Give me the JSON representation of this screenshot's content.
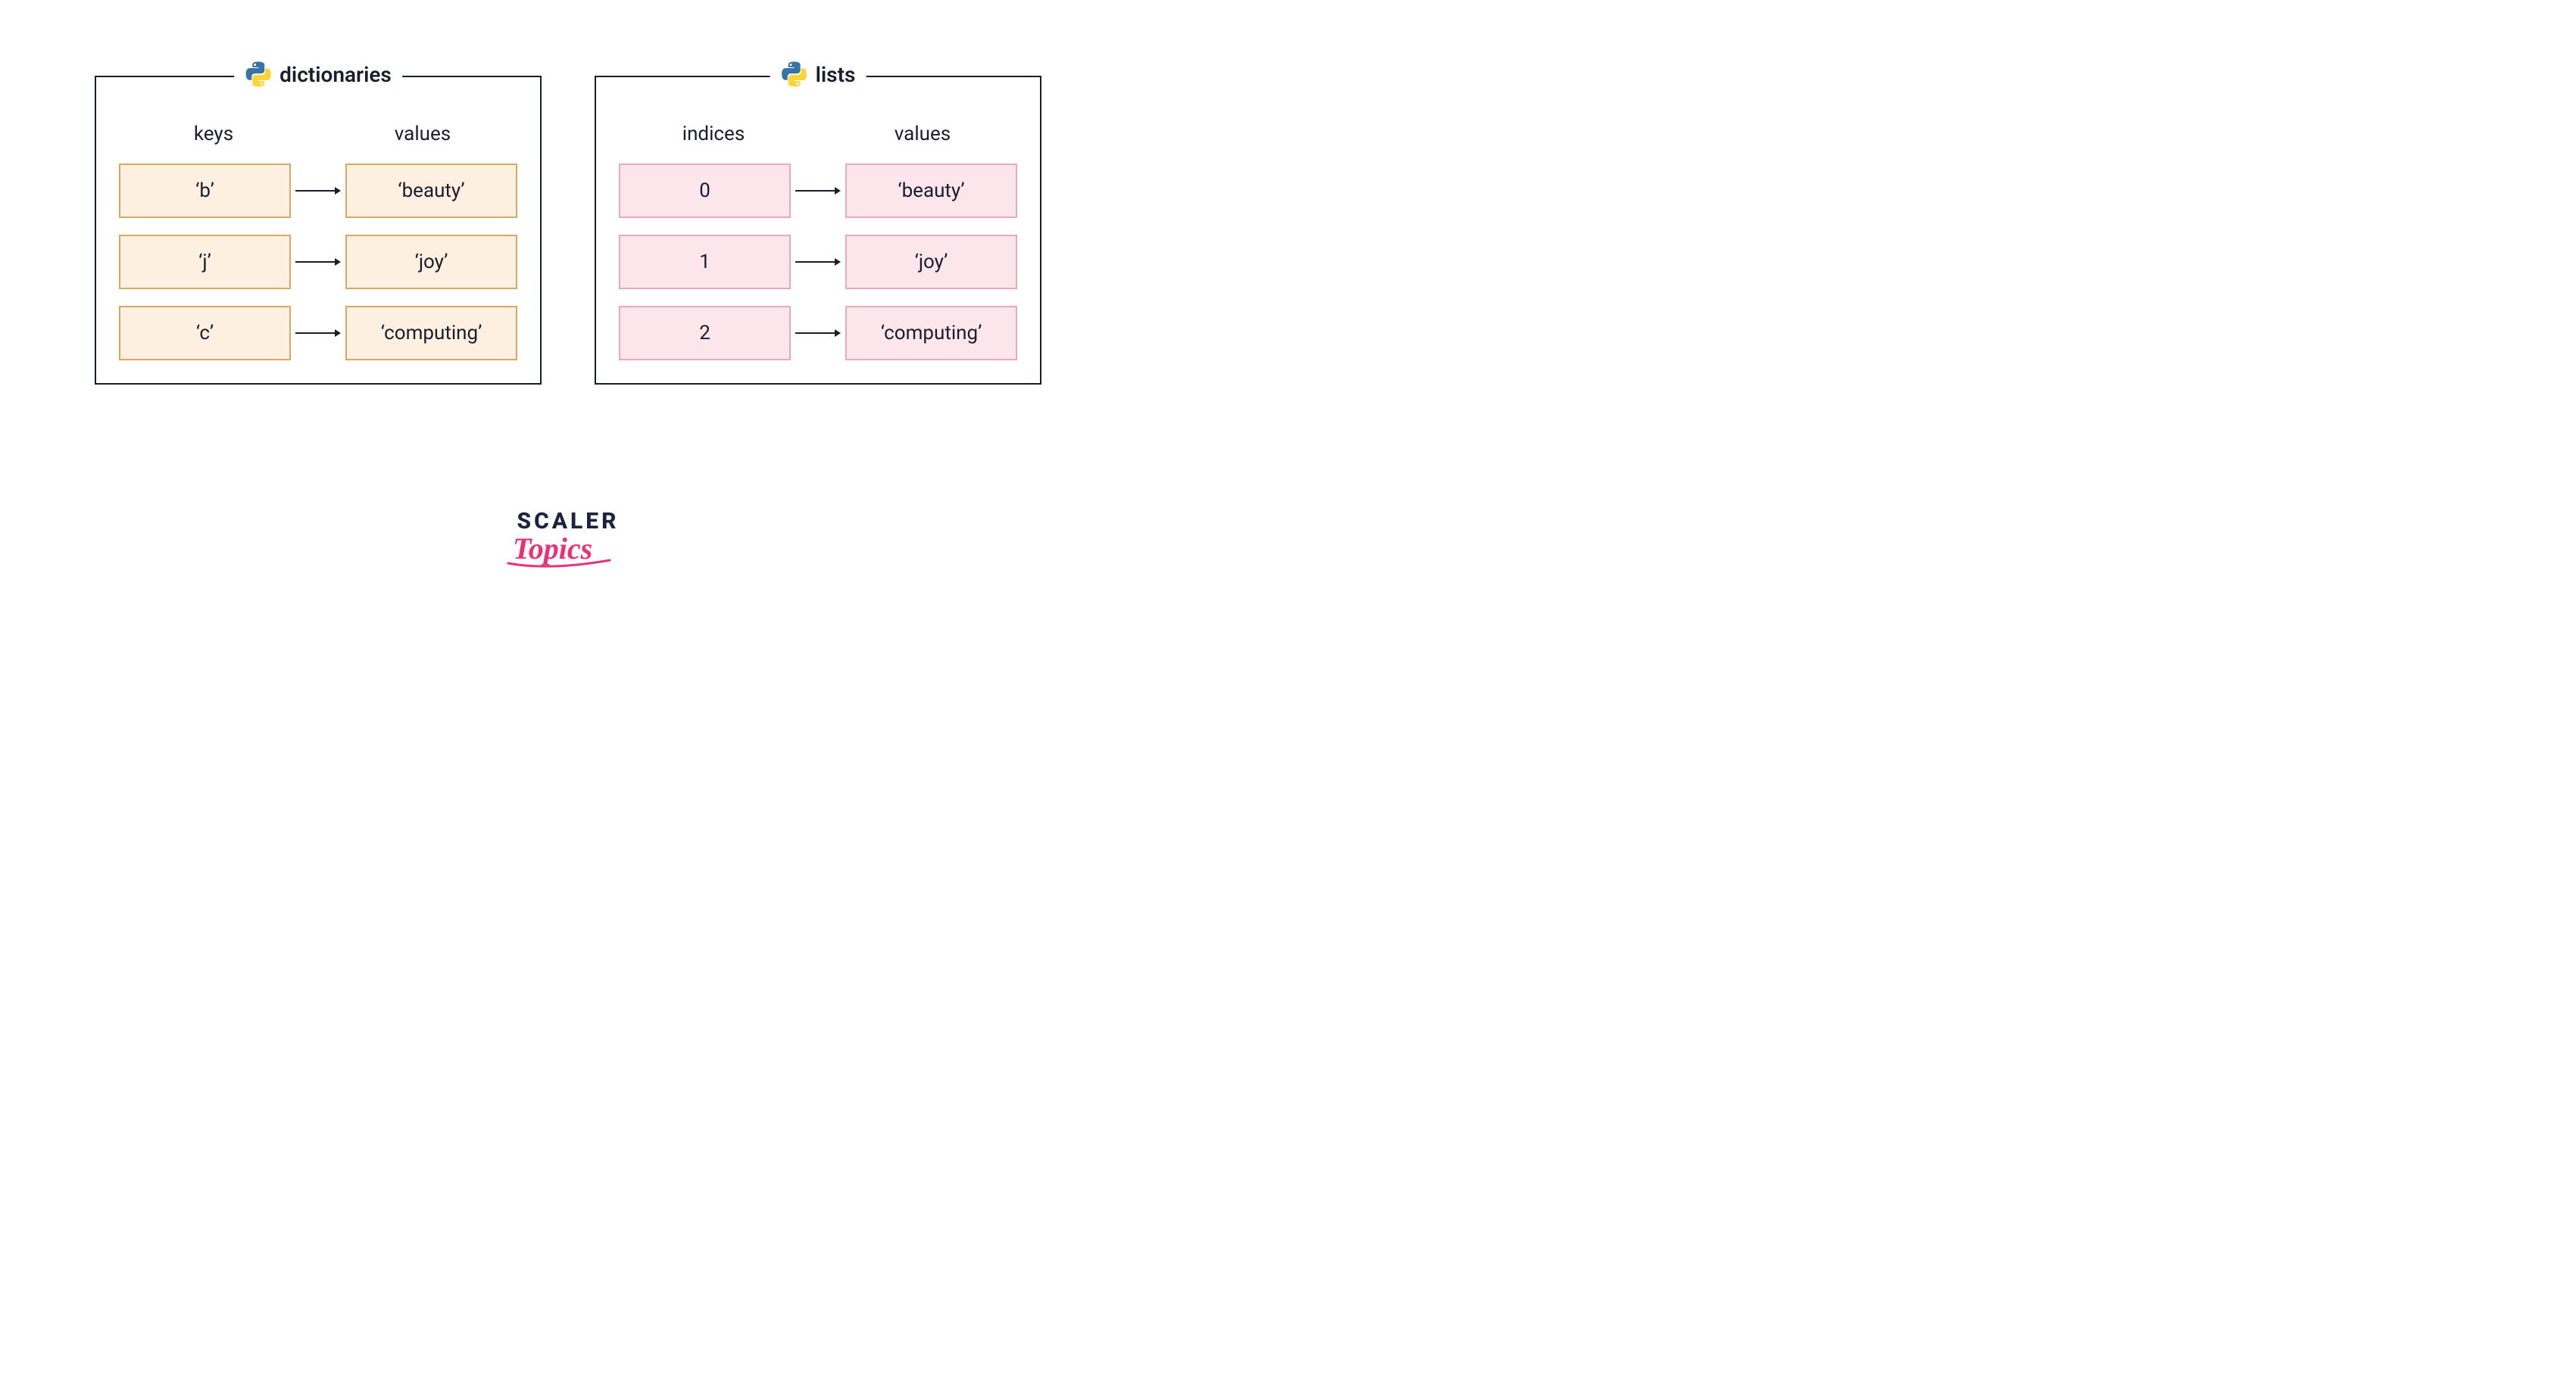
{
  "panels": {
    "left": {
      "title": "dictionaries",
      "leftHeader": "keys",
      "rightHeader": "values",
      "rows": [
        {
          "key": "‘b’",
          "value": "‘beauty’"
        },
        {
          "key": "‘j’",
          "value": "‘joy’"
        },
        {
          "key": "‘c’",
          "value": "‘computing’"
        }
      ]
    },
    "right": {
      "title": "lists",
      "leftHeader": "indices",
      "rightHeader": "values",
      "rows": [
        {
          "key": "0",
          "value": "‘beauty’"
        },
        {
          "key": "1",
          "value": "‘joy’"
        },
        {
          "key": "2",
          "value": "‘computing’"
        }
      ]
    }
  },
  "footer": {
    "line1": "SCALER",
    "line2": "Topics"
  },
  "colors": {
    "border": "#1a1d2e",
    "creamFill": "#fdf0e0",
    "creamBorder": "#d9a864",
    "pinkFill": "#fce6ec",
    "pinkBorder": "#e8a9bd",
    "arrow": "#1a1d2e",
    "topicsPink": "#e8317a"
  }
}
